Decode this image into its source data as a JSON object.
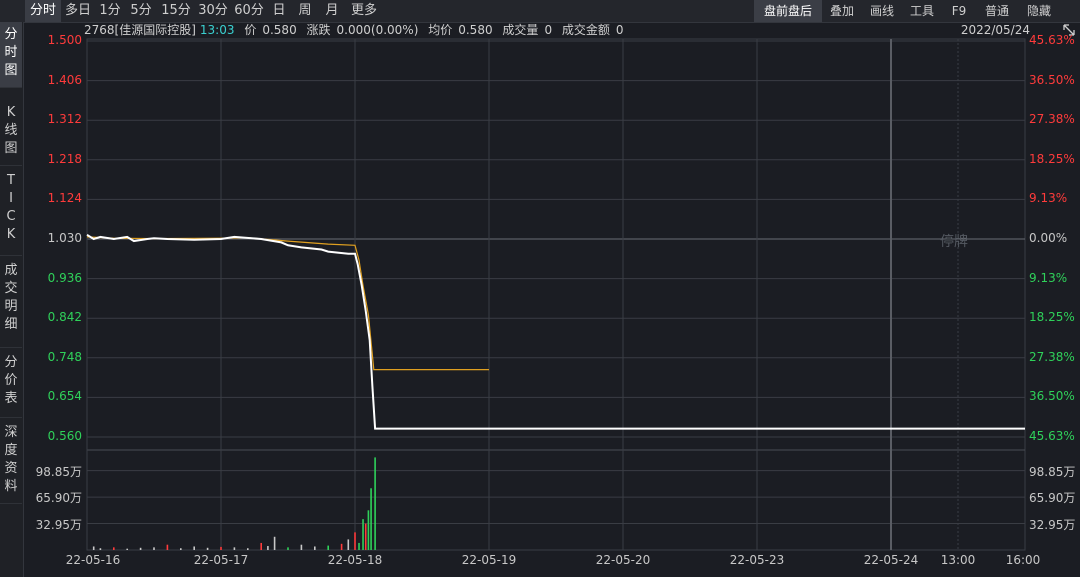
{
  "toolbar": {
    "periods": [
      "分时",
      "多日",
      "1分",
      "5分",
      "15分",
      "30分",
      "60分",
      "日",
      "周",
      "月",
      "更多"
    ],
    "active_period": "分时",
    "right_buttons": [
      "盘前盘后",
      "叠加",
      "画线",
      "工具",
      "F9",
      "普通",
      "隐藏"
    ],
    "active_right": "盘前盘后"
  },
  "sidebar": {
    "tabs": [
      "分\n时\n图",
      "K\n线\n图",
      "T\nI\nC\nK",
      "成\n交\n明\n细",
      "分\n价\n表",
      "深\n度\n资\n料"
    ]
  },
  "info": {
    "stock": "2768[佳源国际控股]",
    "time": "13:03",
    "price_label": "价",
    "price": "0.580",
    "change_label": "涨跌",
    "change": "0.000(0.00%)",
    "avg_label": "均价",
    "avg": "0.580",
    "volume_label": "成交量",
    "volume": "0",
    "amount_label": "成交金额",
    "amount": "0",
    "date": "2022/05/24"
  },
  "suspended_label": "停牌",
  "colors": {
    "up": "#ff3b3b",
    "down": "#2fd15a",
    "neutral": "#c8c8c8",
    "price_line": "#ffffff",
    "avg_line": "#e0a020",
    "grid": "#3a3d44"
  },
  "chart_data": {
    "type": "line",
    "price_axis": {
      "ticks": [
        "1.500",
        "1.406",
        "1.312",
        "1.218",
        "1.124",
        "1.030",
        "0.936",
        "0.842",
        "0.748",
        "0.654",
        "0.560"
      ],
      "ylim": [
        0.56,
        1.5
      ],
      "pre_close": 1.03
    },
    "pct_axis": {
      "ticks": [
        "45.63%",
        "36.50%",
        "27.38%",
        "18.25%",
        "9.13%",
        "0.00%",
        "9.13%",
        "18.25%",
        "27.38%",
        "36.50%",
        "45.63%"
      ]
    },
    "volume_axis": {
      "ticks": [
        "98.85万",
        "65.90万",
        "32.95万"
      ],
      "ylim": [
        0,
        1100000
      ]
    },
    "x_labels": [
      "22-05-16",
      "22-05-17",
      "22-05-18",
      "22-05-19",
      "22-05-20",
      "22-05-23",
      "22-05-24",
      "13:00",
      "16:00"
    ],
    "x_domain": [
      0,
      7
    ],
    "x_label_positions": [
      0,
      1,
      2,
      3,
      4,
      5,
      6,
      6.5,
      7
    ],
    "series": [
      {
        "name": "价",
        "x": [
          0,
          0.05,
          0.1,
          0.2,
          0.3,
          0.35,
          0.45,
          0.5,
          0.6,
          0.8,
          1.0,
          1.1,
          1.3,
          1.45,
          1.5,
          1.6,
          1.75,
          1.8,
          1.95,
          2.0,
          2.02,
          2.05,
          2.08,
          2.11,
          2.13,
          2.15,
          3,
          4,
          5,
          6,
          7
        ],
        "y": [
          1.04,
          1.03,
          1.035,
          1.03,
          1.035,
          1.025,
          1.03,
          1.032,
          1.03,
          1.028,
          1.03,
          1.035,
          1.03,
          1.022,
          1.015,
          1.01,
          1.005,
          1.0,
          0.995,
          0.995,
          0.97,
          0.92,
          0.86,
          0.79,
          0.68,
          0.58,
          0.58,
          0.58,
          0.58,
          0.58,
          0.58
        ]
      },
      {
        "name": "均价",
        "x": [
          0,
          0.2,
          0.5,
          1.0,
          1.2,
          1.5,
          1.8,
          2.0,
          2.03,
          2.06,
          2.1,
          2.14,
          2.3,
          3.0
        ],
        "y": [
          1.035,
          1.032,
          1.031,
          1.032,
          1.033,
          1.025,
          1.018,
          1.015,
          0.98,
          0.92,
          0.85,
          0.72,
          0.72,
          0.72
        ]
      }
    ],
    "volume": {
      "x": [
        0.05,
        0.1,
        0.2,
        0.3,
        0.4,
        0.5,
        0.6,
        0.7,
        0.8,
        0.9,
        1.0,
        1.1,
        1.2,
        1.3,
        1.35,
        1.4,
        1.5,
        1.6,
        1.7,
        1.8,
        1.9,
        1.95,
        2.0,
        2.03,
        2.06,
        2.08,
        2.1,
        2.12,
        2.15
      ],
      "values": [
        40000,
        20000,
        30000,
        15000,
        25000,
        30000,
        60000,
        20000,
        40000,
        25000,
        35000,
        30000,
        20000,
        80000,
        45000,
        150000,
        30000,
        60000,
        40000,
        50000,
        70000,
        120000,
        200000,
        80000,
        350000,
        300000,
        450000,
        700000,
        1050000
      ],
      "colors": [
        "neutral",
        "neutral",
        "up",
        "neutral",
        "neutral",
        "neutral",
        "up",
        "neutral",
        "neutral",
        "neutral",
        "up",
        "neutral",
        "neutral",
        "up",
        "neutral",
        "neutral",
        "down",
        "neutral",
        "neutral",
        "down",
        "up",
        "neutral",
        "up",
        "down",
        "down",
        "up",
        "down",
        "down",
        "down"
      ]
    }
  }
}
